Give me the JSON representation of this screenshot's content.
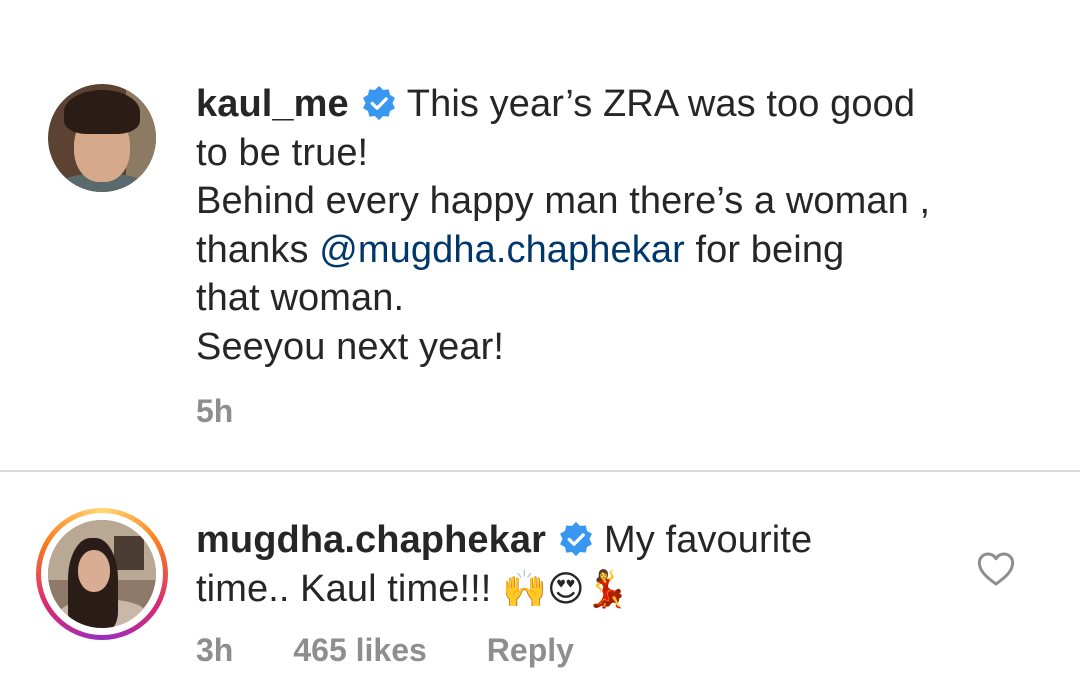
{
  "caption": {
    "username": "kaul_me",
    "verified_icon": "verified-badge-icon",
    "line1_rest": "This year’s ZRA was too good",
    "line2": "to be true!",
    "line3": "Behind every happy man there’s a woman ,",
    "line4_pre": "thanks ",
    "mention": "@mugdha.chaphekar",
    "line4_post": " for being",
    "line5": "that woman.",
    "line6": "Seeyou next year!",
    "time": "5h"
  },
  "comment": {
    "username": "mugdha.chaphekar",
    "verified_icon": "verified-badge-icon",
    "text_line1_rest": "My favourite",
    "text_line2": "time.. Kaul time!!! ",
    "emojis": "🙌😍💃",
    "time": "3h",
    "likes": "465 likes",
    "reply_label": "Reply",
    "like_icon": "heart-outline-icon"
  },
  "colors": {
    "verified": "#3897f0",
    "mention": "#00376b",
    "meta": "#8e8e8e",
    "divider": "#dbdbdb",
    "story_ring": [
      "#feda75",
      "#fa7e1e",
      "#d62976",
      "#962fbf"
    ]
  }
}
